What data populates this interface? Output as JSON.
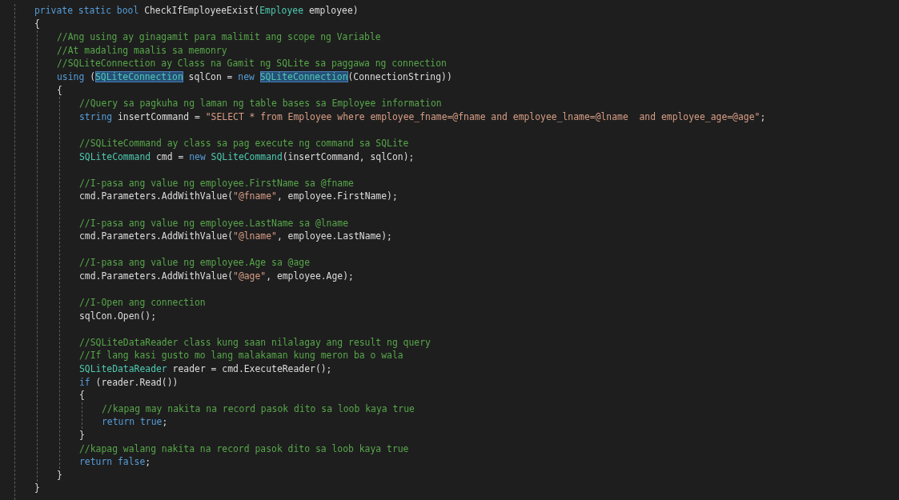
{
  "editor": {
    "lines": [
      {
        "kind": "block",
        "children": [
          {
            "kind": "code",
            "tokens": [
              {
                "kind": "kw",
                "t": "private static bool "
              },
              {
                "kind": "plain",
                "t": "CheckIfEmployeeExist("
              },
              {
                "kind": "type",
                "t": "Employee"
              },
              {
                "kind": "plain",
                "t": " employee)"
              }
            ]
          },
          {
            "kind": "code",
            "tokens": [
              {
                "kind": "plain",
                "t": "{"
              }
            ]
          },
          {
            "kind": "block",
            "children": [
              {
                "kind": "code",
                "tokens": [
                  {
                    "kind": "comment",
                    "t": "//Ang using ay ginagamit para malimit ang scope ng Variable"
                  }
                ]
              },
              {
                "kind": "code",
                "tokens": [
                  {
                    "kind": "comment",
                    "t": "//At madaling maalis sa memonry"
                  }
                ]
              },
              {
                "kind": "code",
                "tokens": [
                  {
                    "kind": "comment",
                    "t": "//SQLiteConnection ay Class na Gamit ng SQLite sa paggawa ng connection"
                  }
                ]
              },
              {
                "kind": "code",
                "tokens": [
                  {
                    "kind": "kw",
                    "t": "using"
                  },
                  {
                    "kind": "plain",
                    "t": " ("
                  },
                  {
                    "kind": "ref",
                    "t": "SQLiteConnection"
                  },
                  {
                    "kind": "plain",
                    "t": " sqlCon = "
                  },
                  {
                    "kind": "kw",
                    "t": "new "
                  },
                  {
                    "kind": "ref",
                    "t": "SQLiteConnection"
                  },
                  {
                    "kind": "plain",
                    "t": "(ConnectionString))"
                  }
                ]
              },
              {
                "kind": "code",
                "tokens": [
                  {
                    "kind": "plain",
                    "t": "{"
                  }
                ]
              },
              {
                "kind": "block",
                "children": [
                  {
                    "kind": "code",
                    "tokens": [
                      {
                        "kind": "comment",
                        "t": "//Query sa pagkuha ng laman ng table bases sa Employee information"
                      }
                    ]
                  },
                  {
                    "kind": "code",
                    "tokens": [
                      {
                        "kind": "kw",
                        "t": "string"
                      },
                      {
                        "kind": "plain",
                        "t": " insertCommand = "
                      },
                      {
                        "kind": "str",
                        "t": "\"SELECT * from Employee where employee_fname=@fname and employee_lname=@lname  and employee_age=@age\""
                      },
                      {
                        "kind": "plain",
                        "t": ";"
                      }
                    ]
                  },
                  {
                    "kind": "blank"
                  },
                  {
                    "kind": "code",
                    "tokens": [
                      {
                        "kind": "comment",
                        "t": "//SQLiteCommand ay class sa pag execute ng command sa SQLite"
                      }
                    ]
                  },
                  {
                    "kind": "code",
                    "tokens": [
                      {
                        "kind": "type",
                        "t": "SQLiteCommand"
                      },
                      {
                        "kind": "plain",
                        "t": " cmd = "
                      },
                      {
                        "kind": "kw",
                        "t": "new "
                      },
                      {
                        "kind": "type",
                        "t": "SQLiteCommand"
                      },
                      {
                        "kind": "plain",
                        "t": "(insertCommand, sqlCon);"
                      }
                    ]
                  },
                  {
                    "kind": "blank"
                  },
                  {
                    "kind": "code",
                    "tokens": [
                      {
                        "kind": "comment",
                        "t": "//I-pasa ang value ng employee.FirstName sa @fname"
                      }
                    ]
                  },
                  {
                    "kind": "code",
                    "tokens": [
                      {
                        "kind": "plain",
                        "t": "cmd.Parameters.AddWithValue("
                      },
                      {
                        "kind": "str",
                        "t": "\"@fname\""
                      },
                      {
                        "kind": "plain",
                        "t": ", employee.FirstName);"
                      }
                    ]
                  },
                  {
                    "kind": "blank"
                  },
                  {
                    "kind": "code",
                    "tokens": [
                      {
                        "kind": "comment",
                        "t": "//I-pasa ang value ng employee.LastName sa @lname"
                      }
                    ]
                  },
                  {
                    "kind": "code",
                    "tokens": [
                      {
                        "kind": "plain",
                        "t": "cmd.Parameters.AddWithValue("
                      },
                      {
                        "kind": "str",
                        "t": "\"@lname\""
                      },
                      {
                        "kind": "plain",
                        "t": ", employee.LastName);"
                      }
                    ]
                  },
                  {
                    "kind": "blank"
                  },
                  {
                    "kind": "code",
                    "tokens": [
                      {
                        "kind": "comment",
                        "t": "//I-pasa ang value ng employee.Age sa @age"
                      }
                    ]
                  },
                  {
                    "kind": "code",
                    "tokens": [
                      {
                        "kind": "plain",
                        "t": "cmd.Parameters.AddWithValue("
                      },
                      {
                        "kind": "str",
                        "t": "\"@age\""
                      },
                      {
                        "kind": "plain",
                        "t": ", employee.Age);"
                      }
                    ]
                  },
                  {
                    "kind": "blank"
                  },
                  {
                    "kind": "code",
                    "tokens": [
                      {
                        "kind": "comment",
                        "t": "//I-Open ang connection"
                      }
                    ]
                  },
                  {
                    "kind": "code",
                    "tokens": [
                      {
                        "kind": "plain",
                        "t": "sqlCon.Open();"
                      }
                    ]
                  },
                  {
                    "kind": "blank"
                  },
                  {
                    "kind": "code",
                    "tokens": [
                      {
                        "kind": "comment",
                        "t": "//SQLiteDataReader class kung saan nilalagay ang result ng query"
                      }
                    ]
                  },
                  {
                    "kind": "code",
                    "tokens": [
                      {
                        "kind": "comment",
                        "t": "//If lang kasi gusto mo lang malakaman kung meron ba o wala"
                      }
                    ]
                  },
                  {
                    "kind": "code",
                    "tokens": [
                      {
                        "kind": "type",
                        "t": "SQLiteDataReader"
                      },
                      {
                        "kind": "plain",
                        "t": " reader = cmd.ExecuteReader();"
                      }
                    ]
                  },
                  {
                    "kind": "code",
                    "tokens": [
                      {
                        "kind": "kw",
                        "t": "if"
                      },
                      {
                        "kind": "plain",
                        "t": " (reader.Read())"
                      }
                    ]
                  },
                  {
                    "kind": "code",
                    "tokens": [
                      {
                        "kind": "plain",
                        "t": "{"
                      }
                    ]
                  },
                  {
                    "kind": "block",
                    "children": [
                      {
                        "kind": "code",
                        "tokens": [
                          {
                            "kind": "comment",
                            "t": "//kapag may nakita na record pasok dito sa loob kaya true"
                          }
                        ]
                      },
                      {
                        "kind": "code",
                        "tokens": [
                          {
                            "kind": "kw",
                            "t": "return true"
                          },
                          {
                            "kind": "plain",
                            "t": ";"
                          }
                        ]
                      }
                    ]
                  },
                  {
                    "kind": "code",
                    "tokens": [
                      {
                        "kind": "plain",
                        "t": "}"
                      }
                    ]
                  },
                  {
                    "kind": "code",
                    "tokens": [
                      {
                        "kind": "comment",
                        "t": "//kapag walang nakita na record pasok dito sa loob kaya true"
                      }
                    ]
                  },
                  {
                    "kind": "code",
                    "tokens": [
                      {
                        "kind": "kw",
                        "t": "return false"
                      },
                      {
                        "kind": "plain",
                        "t": ";"
                      }
                    ]
                  }
                ]
              },
              {
                "kind": "code",
                "tokens": [
                  {
                    "kind": "plain",
                    "t": "}"
                  }
                ]
              }
            ]
          },
          {
            "kind": "code",
            "tokens": [
              {
                "kind": "plain",
                "t": "}"
              }
            ]
          }
        ]
      }
    ]
  }
}
